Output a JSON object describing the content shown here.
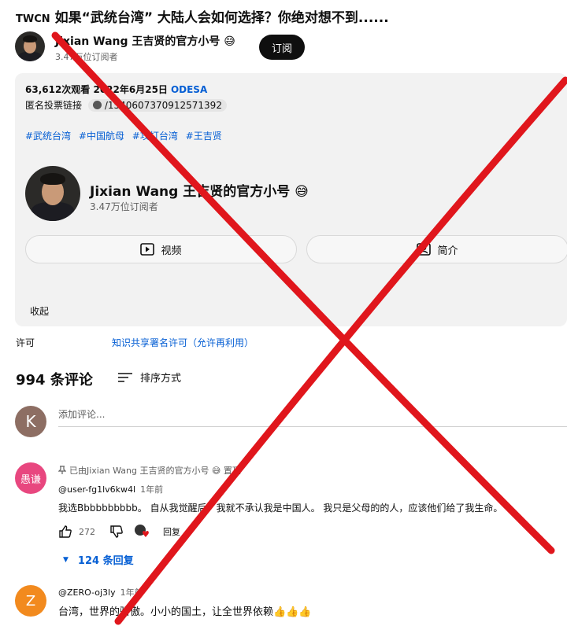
{
  "video": {
    "channel_tag": "TWCN",
    "title": "如果“武统台湾” 大陆人会如何选择？你绝对想不到......"
  },
  "channel": {
    "name": "Jixian Wang 王吉贤的官方小号",
    "emoji": "😅",
    "subscribers": "3.47万位订阅者",
    "subscribe_label": "订阅"
  },
  "description": {
    "stats": "63,612次观看  2022年6月25日",
    "location": "ODESA",
    "vote_label": "匿名投票链接",
    "vote_link": "/1540607370912571392",
    "hashtags": [
      "#武统台湾",
      "#中国航母",
      "#攻打台湾",
      "#王吉贤"
    ],
    "videos_label": "视频",
    "about_label": "简介",
    "collapse_label": "收起"
  },
  "license": {
    "label": "许可",
    "value": "知识共享署名许可（允许再利用）"
  },
  "comments": {
    "count_label": "994 条评论",
    "sort_label": "排序方式",
    "my_avatar_letter": "K",
    "add_placeholder": "添加评论...",
    "items": [
      {
        "avatar_text": "愚谦",
        "pinned": "已由Jixian Wang 王吉贤的官方小号 😅 置顶",
        "author": "@user-fg1lv6kw4l",
        "time": "1年前",
        "text": "我选Bbbbbbbbbb。 自从我觉醒后，我就不承认我是中国人。 我只是父母的的人，应该他们给了我生命。",
        "likes": "272",
        "reply_label": "回复",
        "replies_label": "124 条回复"
      },
      {
        "avatar_text": "Z",
        "author": "@ZERO-oj3ly",
        "time": "1年前",
        "text": "台湾，世界的骄傲。小小的国土，让全世界依赖👍👍👍"
      }
    ]
  },
  "colors": {
    "link_blue": "#065fd4",
    "cross_red": "#e0161c",
    "avatar_pink": "#e8477f",
    "avatar_orange": "#f28a1e",
    "avatar_brown": "#8d6e63"
  }
}
